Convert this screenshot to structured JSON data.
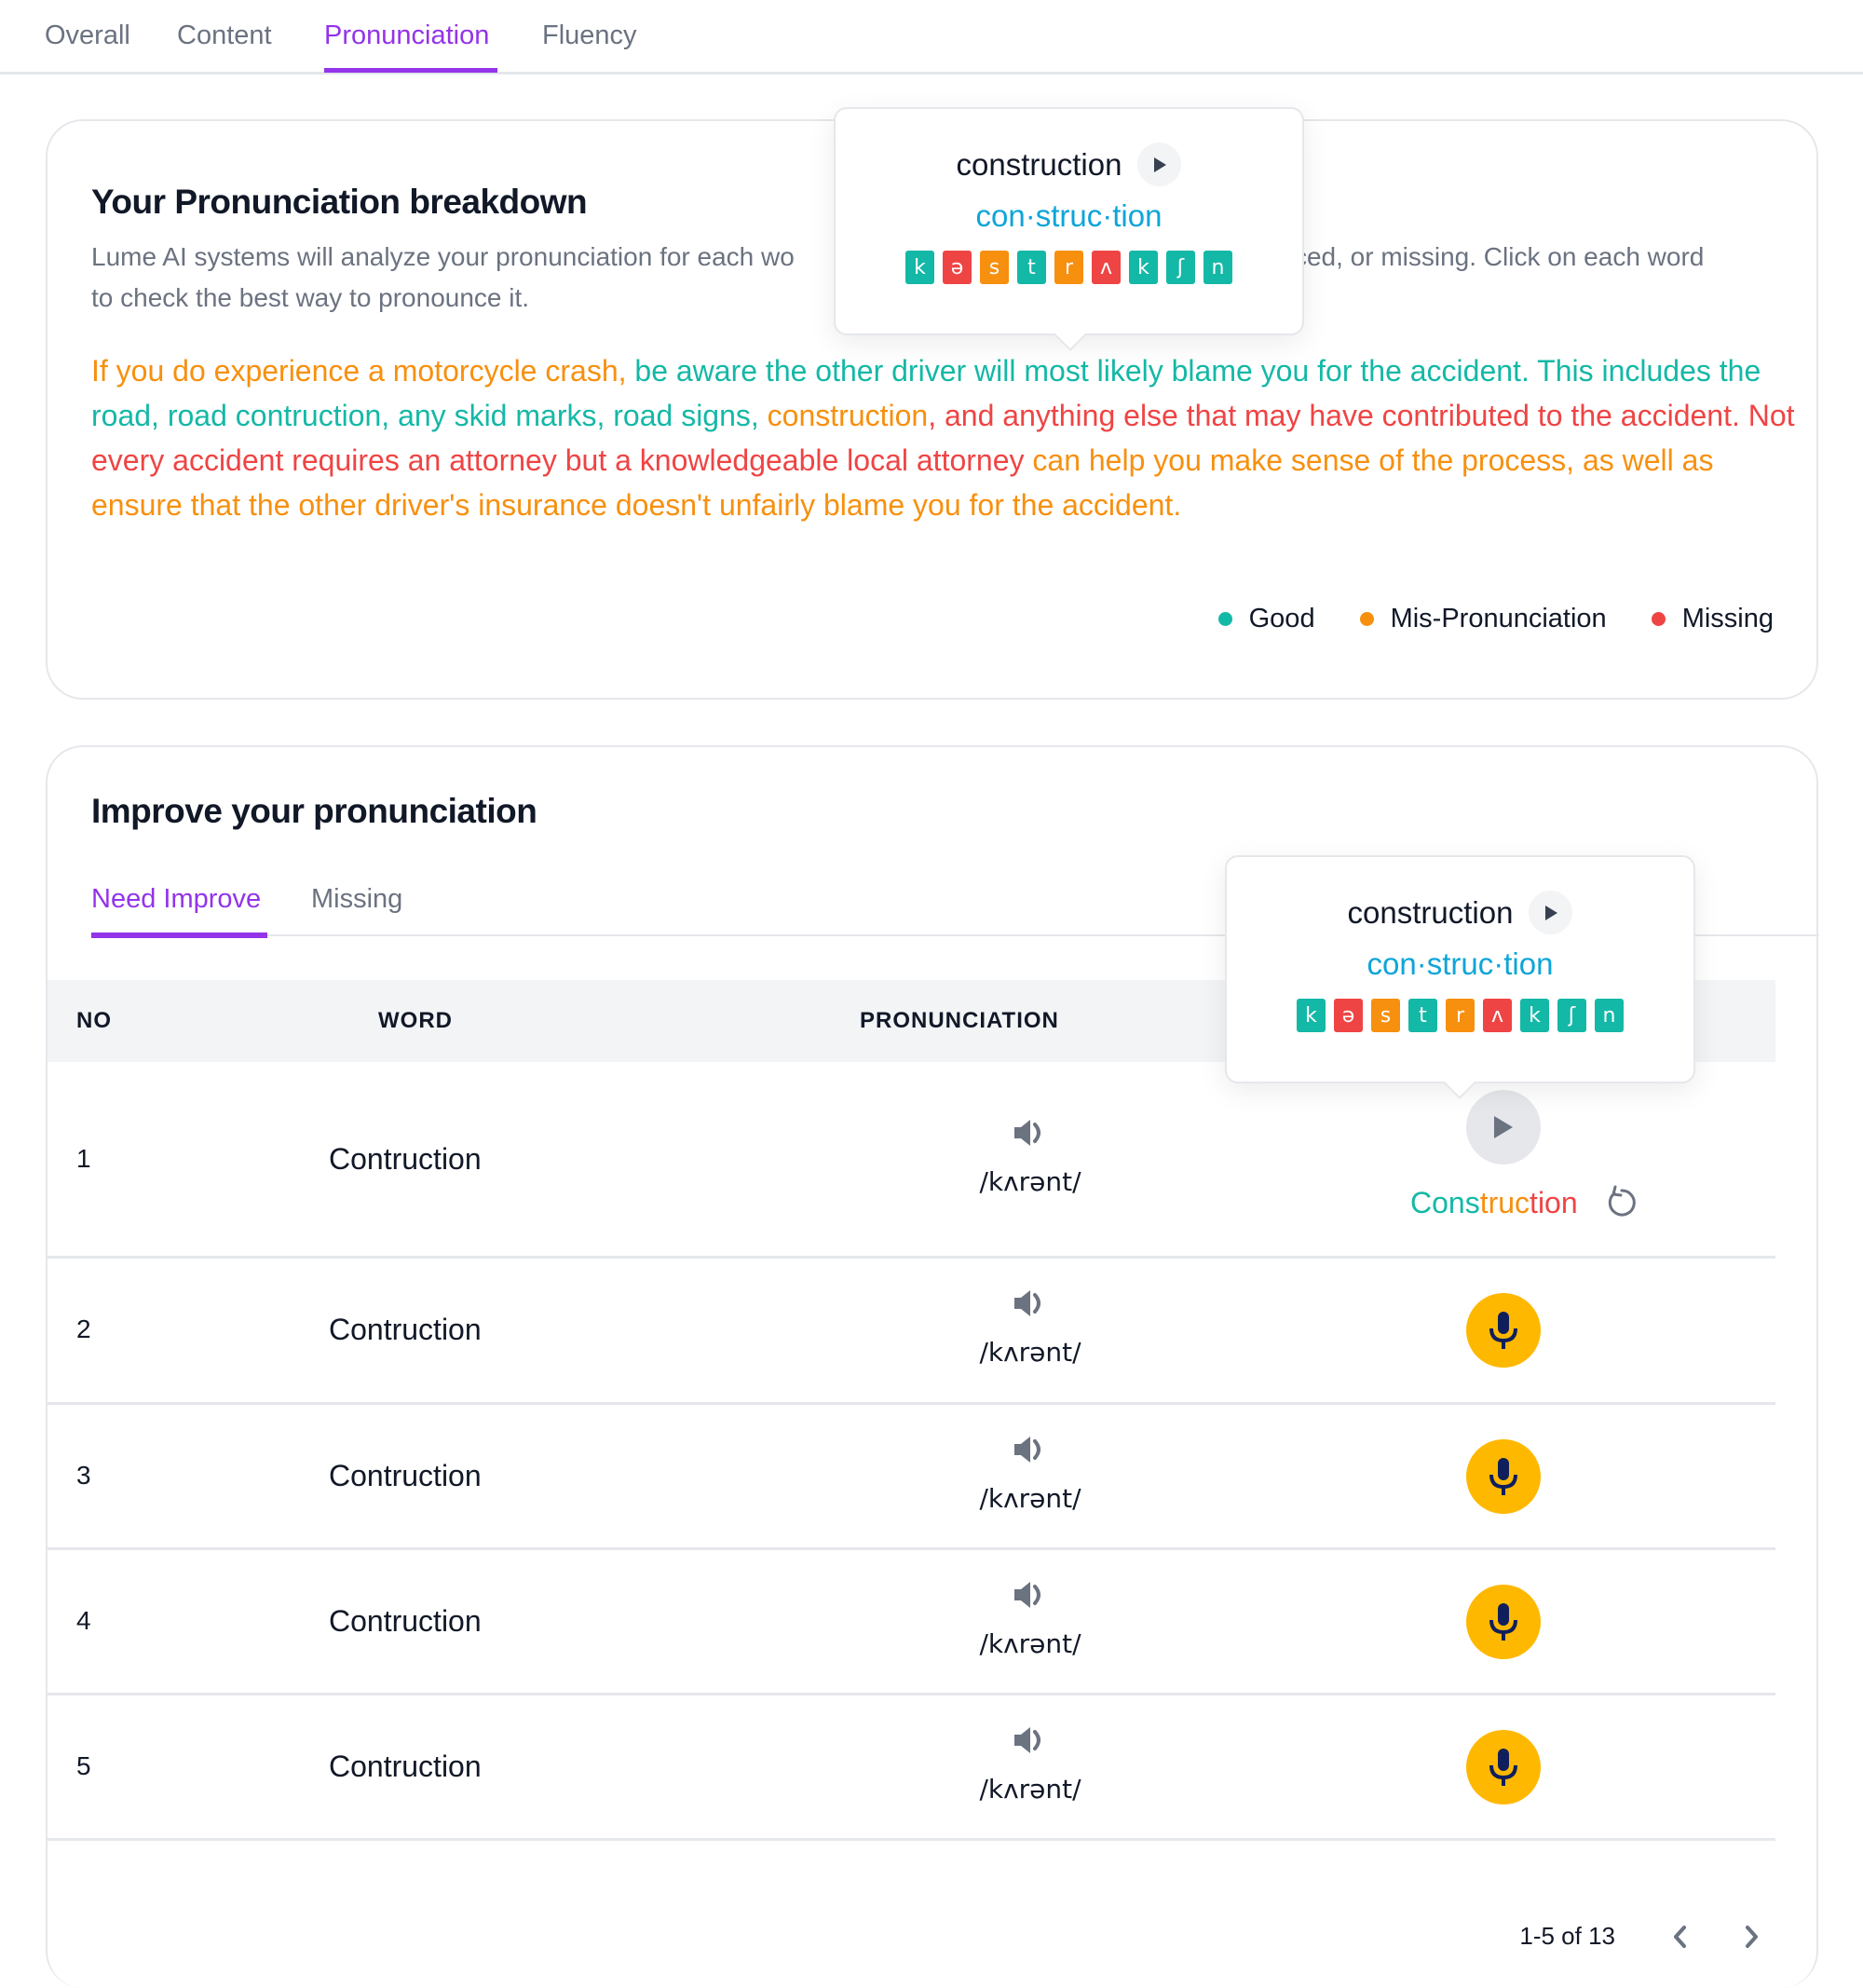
{
  "tabs": [
    {
      "label": "Overall",
      "active": false
    },
    {
      "label": "Content",
      "active": false
    },
    {
      "label": "Pronunciation",
      "active": true
    },
    {
      "label": "Fluency",
      "active": false
    }
  ],
  "colors": {
    "accent": "#9333ea",
    "good": "#14b8a6",
    "mis_pronunciation": "#f7900f",
    "missing": "#ef4444",
    "syllable": "#0ea5d8",
    "mic": "#ffb800"
  },
  "breakdown": {
    "title": "Your Pronunciation breakdown",
    "description_start": "Lume AI systems will analyze your pronunciation for each wo",
    "description_end": "unced, or missing. Click on each word",
    "description_line2": "to check the best way to pronounce it.",
    "passage": [
      {
        "text": "If you do experience a motorcycle crash, ",
        "status": "mis"
      },
      {
        "text": "be aware the other driver will most likely blame you for the accident. This includes the road, road contruction, any skid marks, road signs, ",
        "status": "good"
      },
      {
        "text": "construction",
        "status": "mis"
      },
      {
        "text": ", and anything else that may have contributed to the accident. Not every accident requires an attorney but a knowledgeable local attorney ",
        "status": "miss"
      },
      {
        "text": "can help you make sense of the process, as well as ensure that the other driver's insurance doesn't unfairly blame you for the accident.",
        "status": "mis"
      }
    ],
    "legend": [
      {
        "label": "Good",
        "status": "good"
      },
      {
        "label": "Mis-Pronunciation",
        "status": "mis"
      },
      {
        "label": "Missing",
        "status": "miss"
      }
    ]
  },
  "popover": {
    "word": "construction",
    "syllables": "con·struc·tion",
    "phonemes": [
      {
        "symbol": "k",
        "status": "good"
      },
      {
        "symbol": "ə",
        "status": "miss"
      },
      {
        "symbol": "s",
        "status": "mis"
      },
      {
        "symbol": "t",
        "status": "good"
      },
      {
        "symbol": "r",
        "status": "mis"
      },
      {
        "symbol": "ʌ",
        "status": "miss"
      },
      {
        "symbol": "k",
        "status": "good"
      },
      {
        "symbol": "ʃ",
        "status": "good"
      },
      {
        "symbol": "n",
        "status": "good"
      }
    ]
  },
  "improve": {
    "title": "Improve your pronunciation",
    "sub_tabs": [
      {
        "label": "Need Improve",
        "active": true
      },
      {
        "label": "Missing",
        "active": false
      }
    ],
    "columns": [
      "NO",
      "WORD",
      "PRONUNCIATION"
    ],
    "rows": [
      {
        "no": "1",
        "word": "Contruction",
        "ipa": "/kʌrənt/",
        "state": "recorded",
        "result": [
          {
            "text": "Cons",
            "status": "good"
          },
          {
            "text": "truc",
            "status": "mis"
          },
          {
            "text": "tion",
            "status": "miss"
          }
        ]
      },
      {
        "no": "2",
        "word": "Contruction",
        "ipa": "/kʌrənt/",
        "state": "record"
      },
      {
        "no": "3",
        "word": "Contruction",
        "ipa": "/kʌrənt/",
        "state": "record"
      },
      {
        "no": "4",
        "word": "Contruction",
        "ipa": "/kʌrənt/",
        "state": "record"
      },
      {
        "no": "5",
        "word": "Contruction",
        "ipa": "/kʌrənt/",
        "state": "record"
      }
    ],
    "pagination": {
      "range": "1-5 of 13"
    }
  }
}
